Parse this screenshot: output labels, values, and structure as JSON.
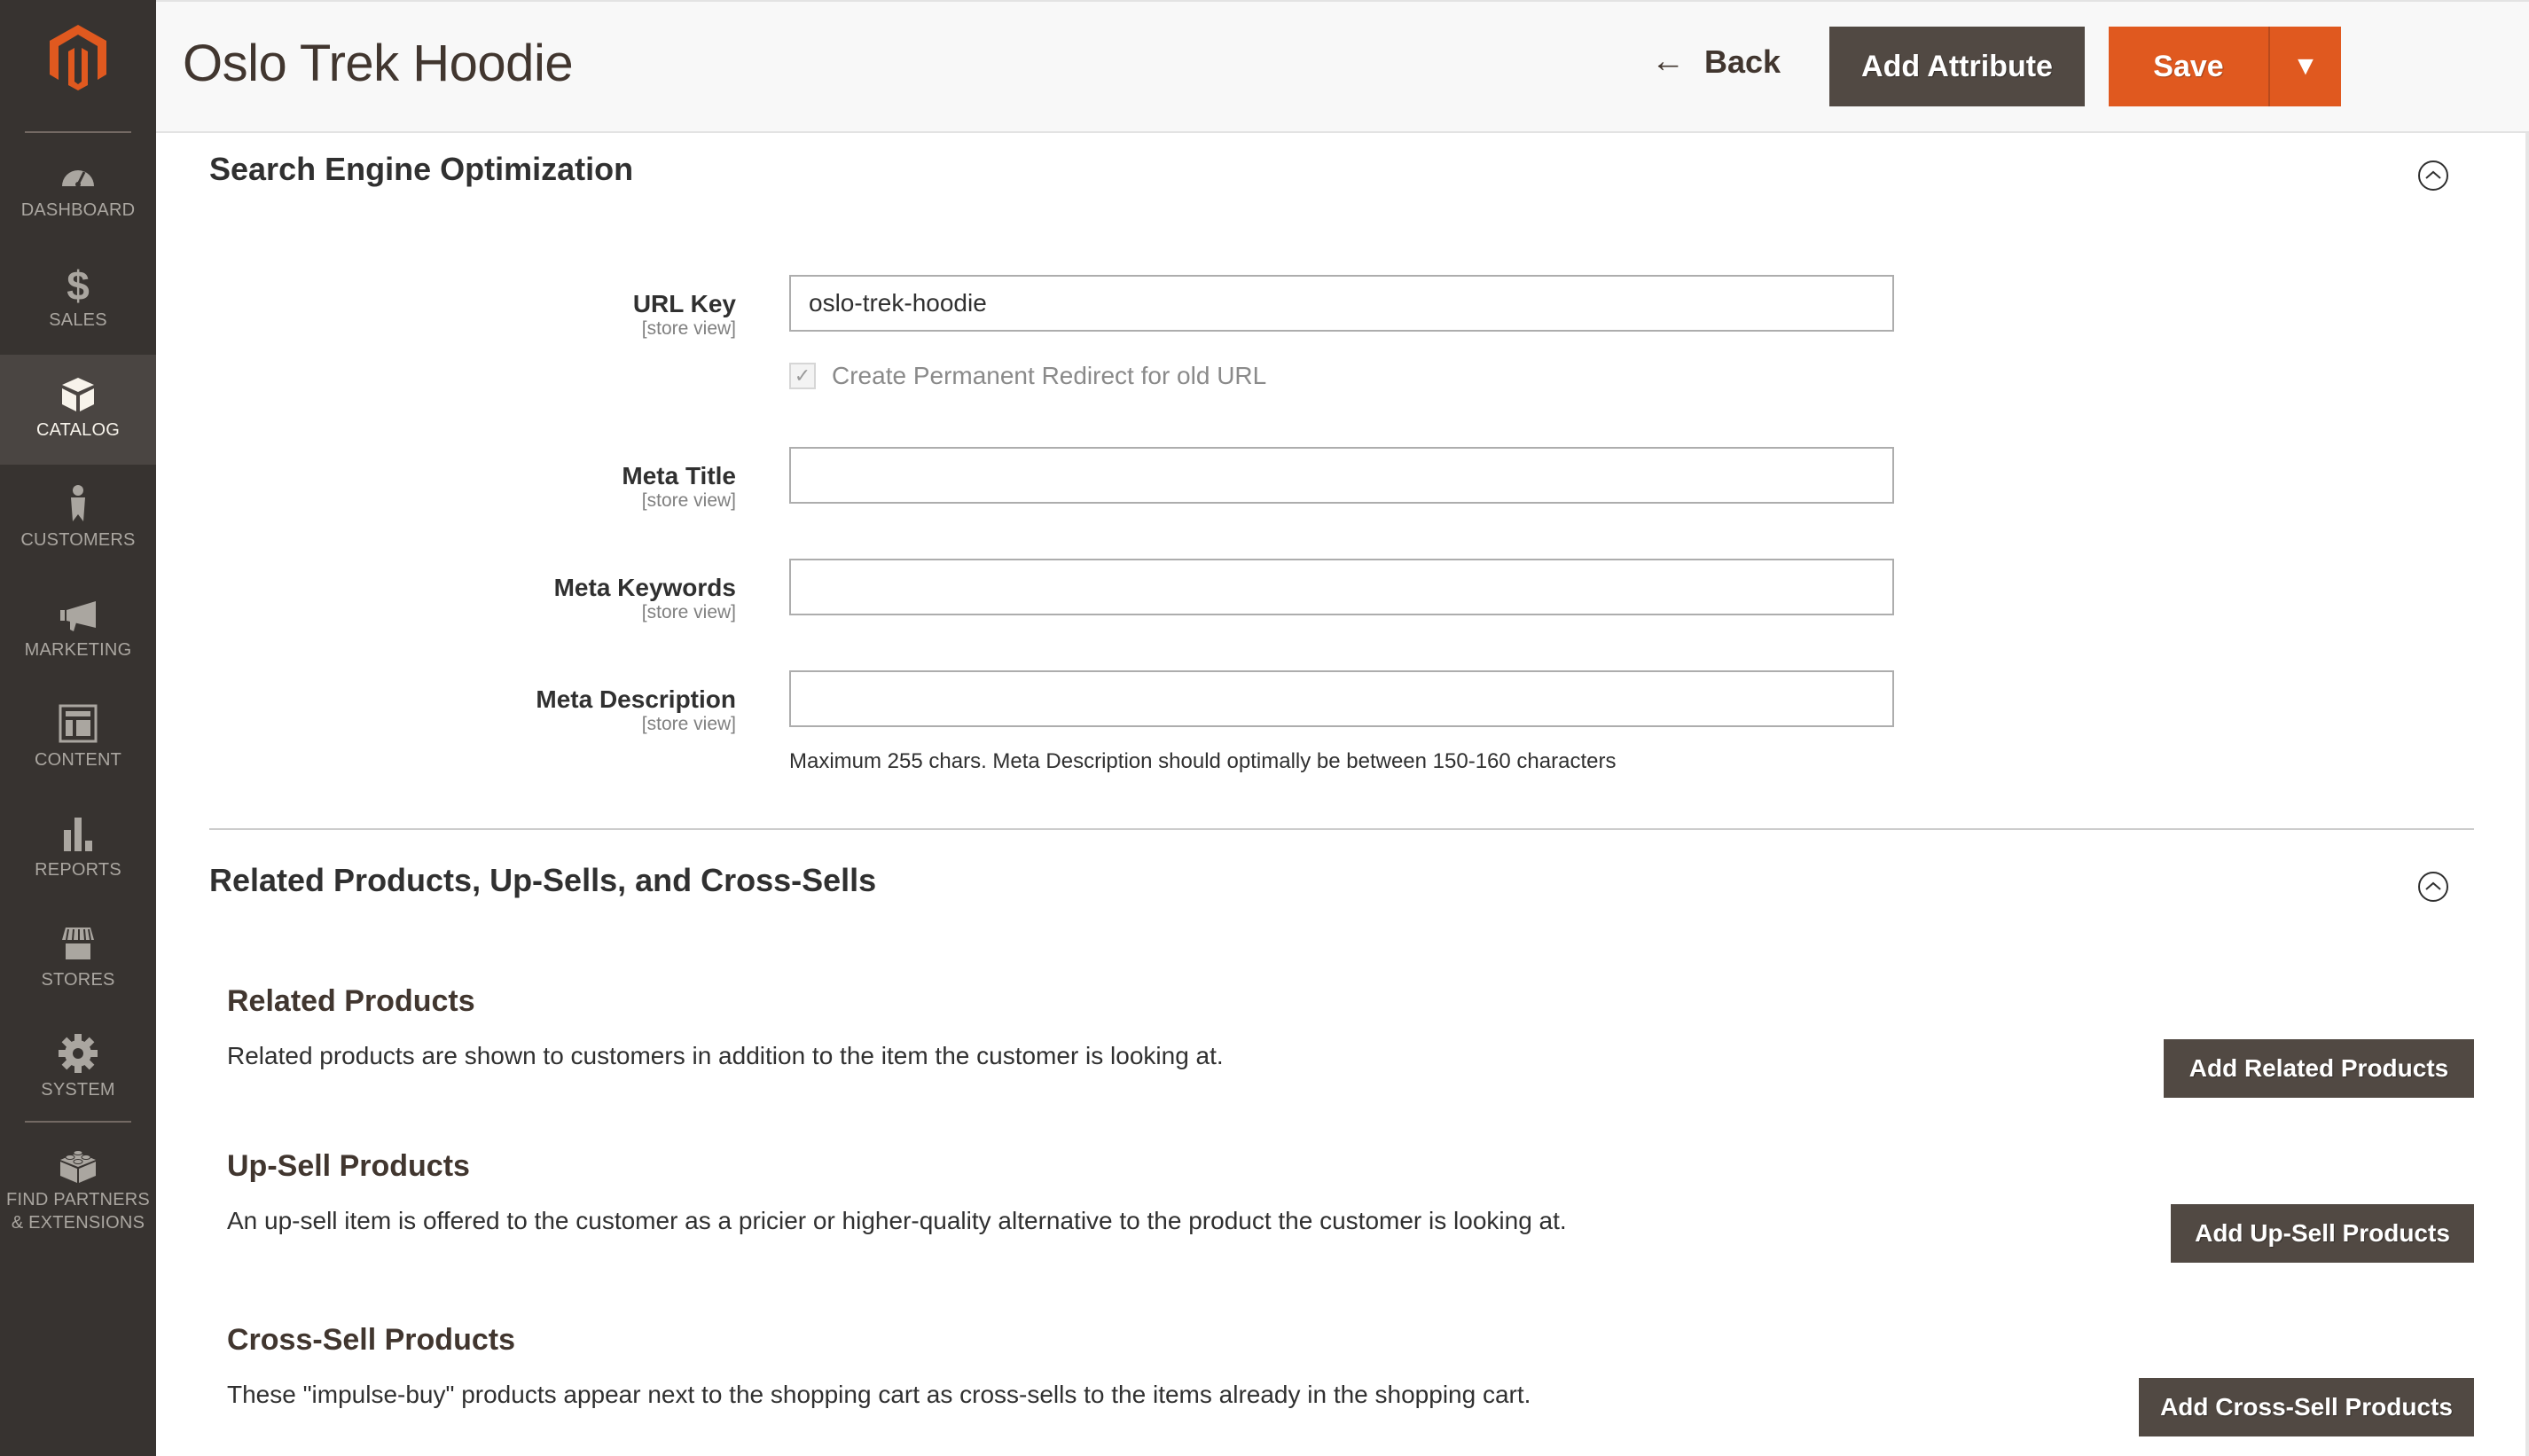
{
  "sidebar": {
    "logo": "magento-logo",
    "items": [
      {
        "label": "DASHBOARD",
        "icon": "dashboard-icon",
        "active": false
      },
      {
        "label": "SALES",
        "icon": "dollar-icon",
        "active": false
      },
      {
        "label": "CATALOG",
        "icon": "box-icon",
        "active": true
      },
      {
        "label": "CUSTOMERS",
        "icon": "person-icon",
        "active": false
      },
      {
        "label": "MARKETING",
        "icon": "megaphone-icon",
        "active": false
      },
      {
        "label": "CONTENT",
        "icon": "layout-icon",
        "active": false
      },
      {
        "label": "REPORTS",
        "icon": "bar-chart-icon",
        "active": false
      },
      {
        "label": "STORES",
        "icon": "storefront-icon",
        "active": false
      },
      {
        "label": "SYSTEM",
        "icon": "gear-icon",
        "active": false
      },
      {
        "label_line1": "FIND PARTNERS",
        "label_line2": "& EXTENSIONS",
        "icon": "lego-brick-icon",
        "active": false
      }
    ]
  },
  "header": {
    "title": "Oslo Trek Hoodie",
    "back_label": "Back",
    "add_attribute_label": "Add Attribute",
    "save_label": "Save",
    "save_toggle": "▼"
  },
  "seo": {
    "title": "Search Engine Optimization",
    "fields": [
      {
        "label": "URL Key",
        "scope": "[store view]",
        "value": "oslo-trek-hoodie"
      },
      {
        "label": "Meta Title",
        "scope": "[store view]",
        "value": ""
      },
      {
        "label": "Meta Keywords",
        "scope": "[store view]",
        "value": ""
      },
      {
        "label": "Meta Description",
        "scope": "[store view]",
        "value": ""
      }
    ],
    "redirect_checkbox": {
      "label": "Create Permanent Redirect for old URL",
      "checked": true,
      "disabled": true
    },
    "meta_description_note": "Maximum 255 chars. Meta Description should optimally be between 150-160 characters"
  },
  "related": {
    "title": "Related Products, Up-Sells, and Cross-Sells",
    "groups": [
      {
        "title": "Related Products",
        "description": "Related products are shown to customers in addition to the item the customer is looking at.",
        "button": "Add Related Products"
      },
      {
        "title": "Up-Sell Products",
        "description": "An up-sell item is offered to the customer as a pricier or higher-quality alternative to the product the customer is looking at.",
        "button": "Add Up-Sell Products"
      },
      {
        "title": "Cross-Sell Products",
        "description": "These \"impulse-buy\" products appear next to the shopping cart as cross-sells to the items already in the shopping cart.",
        "button": "Add Cross-Sell Products"
      }
    ]
  },
  "colors": {
    "sidebar_bg": "#373330",
    "sidebar_active_bg": "#4a4542",
    "accent_orange": "#e0591f",
    "dark_button": "#514943"
  }
}
